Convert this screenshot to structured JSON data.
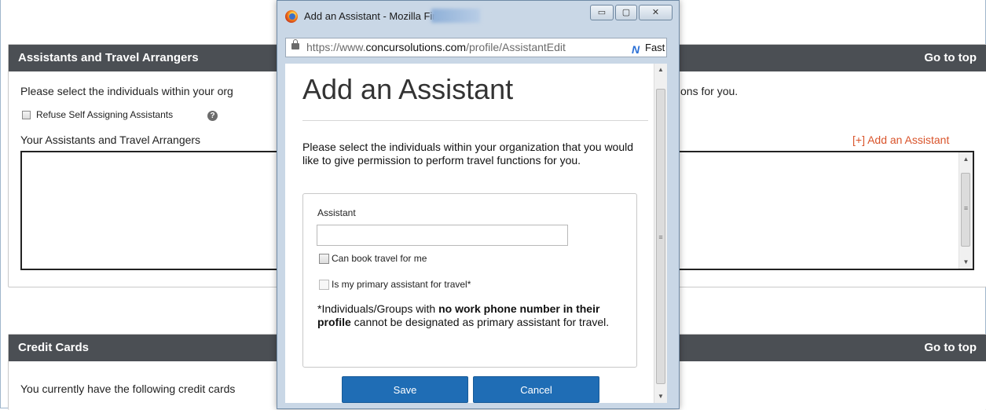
{
  "assistants_panel": {
    "title": "Assistants and Travel Arrangers",
    "go_to_top": "Go to top",
    "description_left": "Please select the individuals within your org",
    "description_right": "ons for you.",
    "refuse_self_assigning_label": "Refuse Self Assigning Assistants",
    "help_glyph": "?",
    "list_title": "Your Assistants and Travel Arrangers",
    "add_link": "[+] Add an Assistant"
  },
  "credit_cards_panel": {
    "title": "Credit Cards",
    "go_to_top": "Go to top",
    "description": "You currently have the following credit cards"
  },
  "popup": {
    "window_title": "Add an Assistant - Mozilla Firefox",
    "controls": {
      "minimize": "▭",
      "maximize": "▢",
      "close": "✕"
    },
    "url_prefix": "https://www.",
    "url_domain": "concursolutions.com",
    "url_rest": "/profile/AssistantEdit",
    "fast_label": "Fast",
    "heading": "Add an Assistant",
    "description": "Please select the individuals within your organization that you would like to give permission to perform travel functions for you.",
    "assistant_label": "Assistant",
    "assistant_value": "",
    "can_book_label": "Can book travel for me",
    "primary_label": "Is my primary assistant for travel*",
    "note_prefix": "*Individuals/Groups with ",
    "note_bold": "no work phone number in their profile",
    "note_suffix": " cannot be designated as primary assistant for travel.",
    "save_label": "Save",
    "cancel_label": "Cancel"
  },
  "icons": {
    "browser": "firefox-icon",
    "secure": "lock-icon",
    "speed": "fast-icon",
    "help": "help-icon"
  },
  "colors": {
    "panel_header": "#4b4f54",
    "add_link": "#d9542b",
    "primary_button": "#1f6db5"
  }
}
